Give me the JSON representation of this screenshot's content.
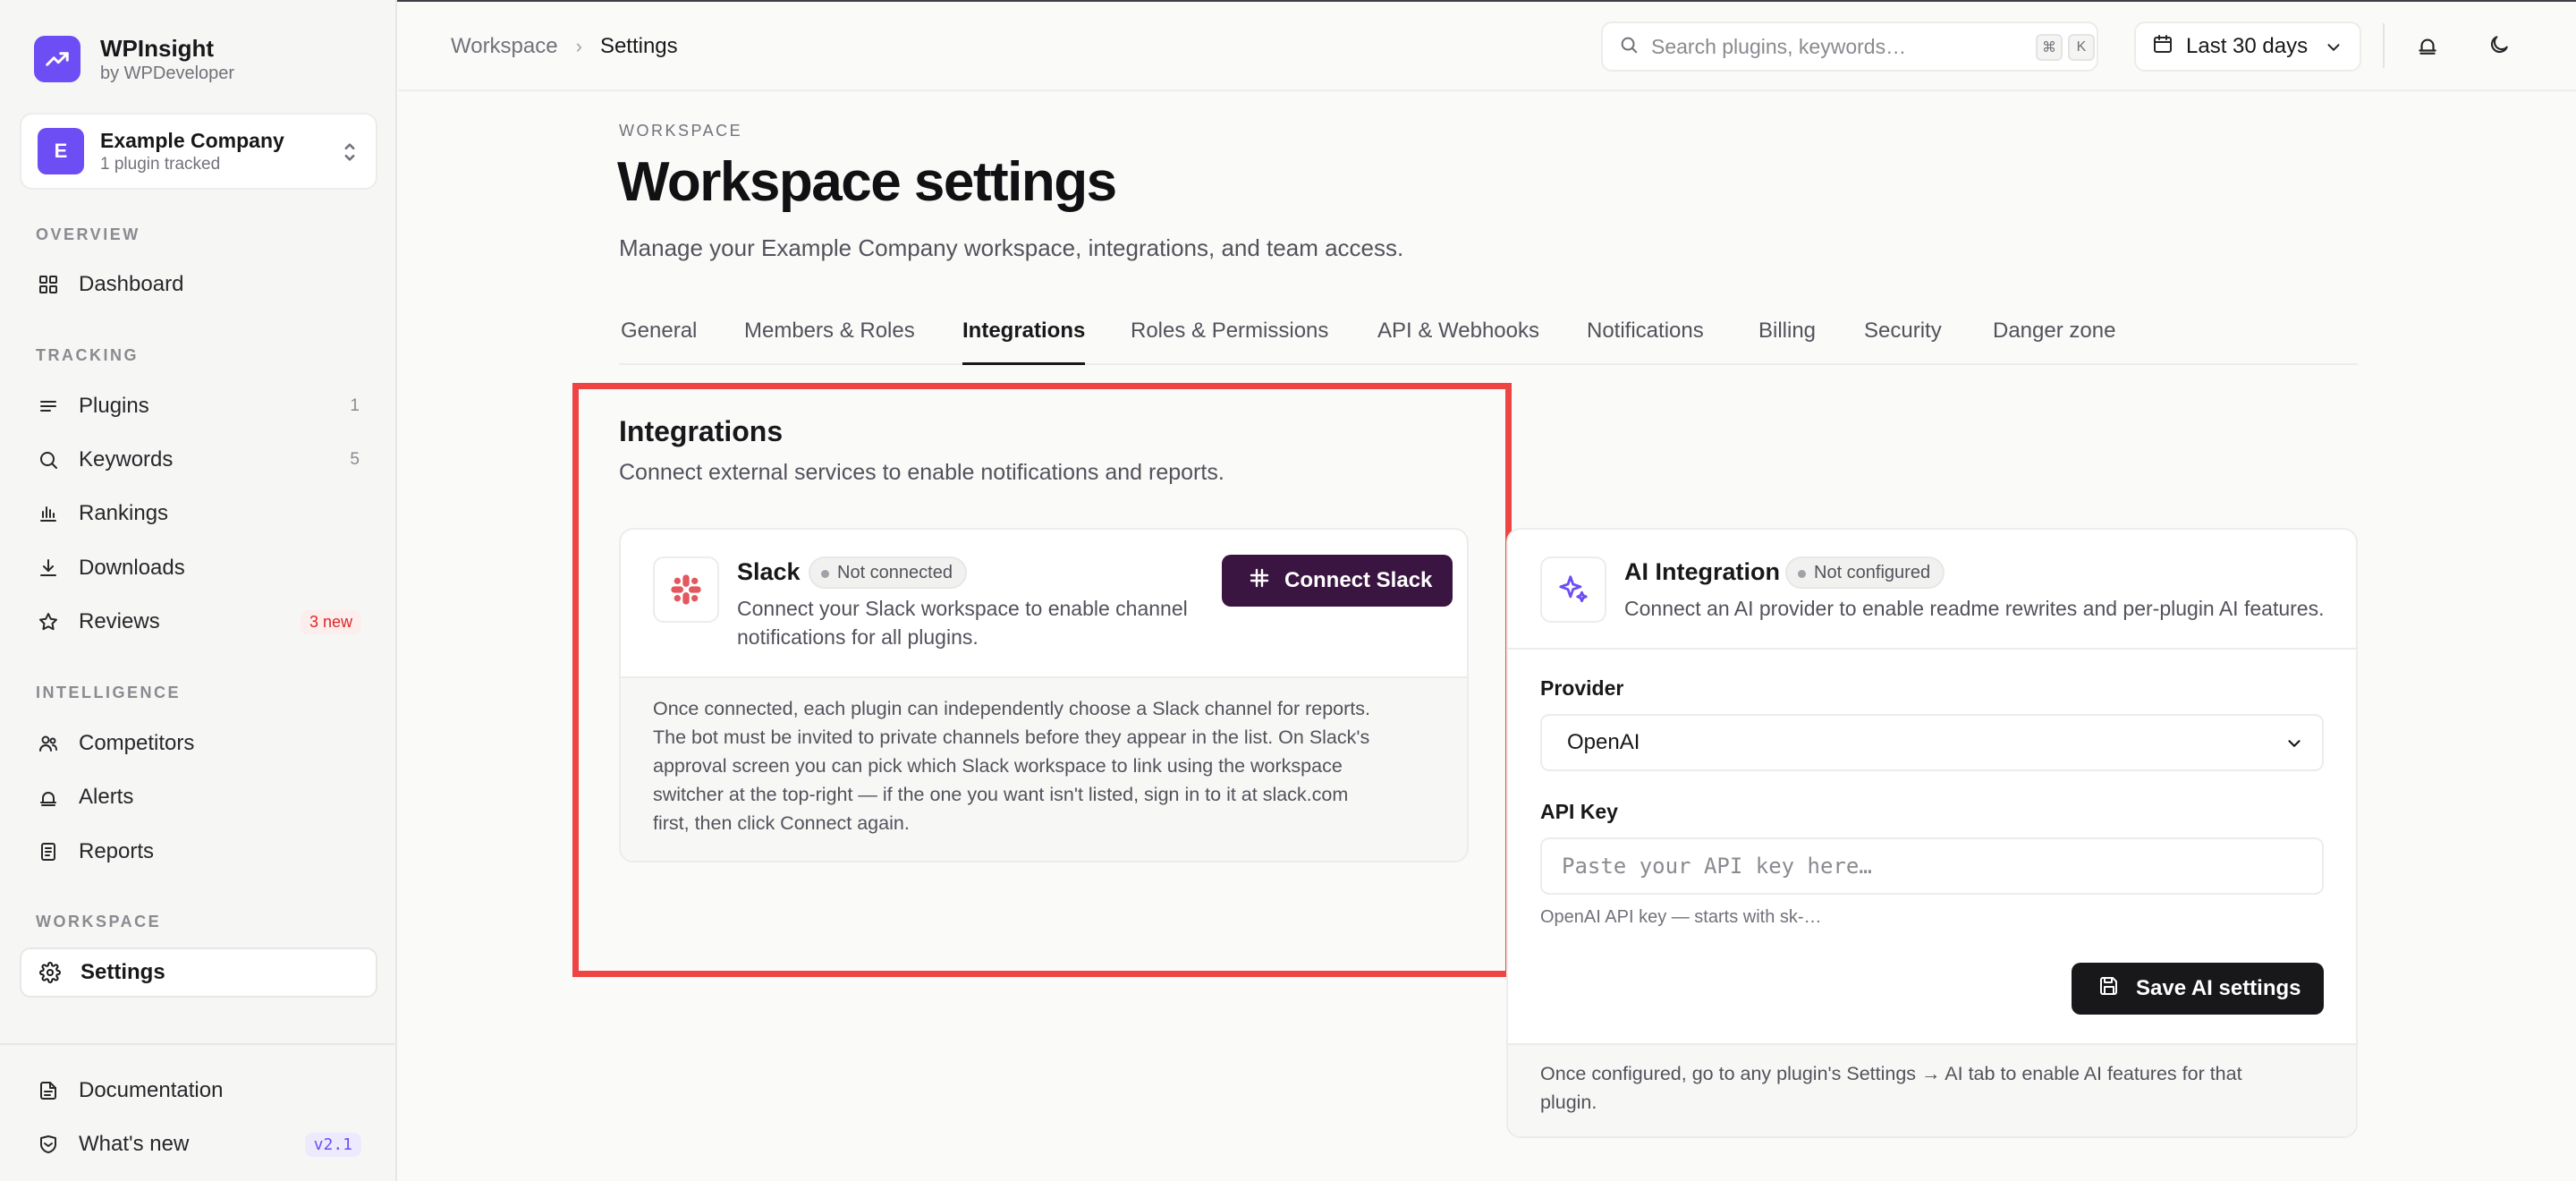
{
  "brand": {
    "name": "WPInsight",
    "sub": "by WPDeveloper"
  },
  "workspace": {
    "avatar": "E",
    "name": "Example Company",
    "sub": "1 plugin tracked"
  },
  "nav": {
    "overview": "OVERVIEW",
    "tracking": "TRACKING",
    "intelligence": "INTELLIGENCE",
    "workspace": "WORKSPACE",
    "dashboard": "Dashboard",
    "plugins": {
      "label": "Plugins",
      "count": "1"
    },
    "keywords": {
      "label": "Keywords",
      "count": "5"
    },
    "rankings": "Rankings",
    "downloads": "Downloads",
    "reviews": {
      "label": "Reviews",
      "badge": "3 new"
    },
    "competitors": "Competitors",
    "alerts": "Alerts",
    "reports": "Reports",
    "settings": "Settings",
    "documentation": "Documentation",
    "whats_new": {
      "label": "What's new",
      "badge": "v2.1"
    }
  },
  "header": {
    "crumb_1": "Workspace",
    "crumb_sep": "›",
    "crumb_2": "Settings",
    "search_placeholder": "Search plugins, keywords…",
    "kbd_1": "⌘",
    "kbd_2": "K",
    "date_range": "Last 30 days"
  },
  "page": {
    "eyebrow": "WORKSPACE",
    "title": "Workspace settings",
    "subtitle": "Manage your Example Company workspace, integrations, and team access."
  },
  "tabs": [
    "General",
    "Members & Roles",
    "Integrations",
    "Roles & Permissions",
    "API & Webhooks",
    "Notifications",
    "Billing",
    "Security",
    "Danger zone"
  ],
  "integrations": {
    "title": "Integrations",
    "subtitle": "Connect external services to enable notifications and reports.",
    "slack": {
      "name": "Slack",
      "status": "Not connected",
      "desc_1": "Connect your Slack workspace to enable channel",
      "desc_2": "notifications for all plugins.",
      "button": "Connect Slack",
      "foot": [
        "Once connected, each plugin can independently choose a Slack channel for reports.",
        "The bot must be invited to private channels before they appear in the list. On Slack's",
        "approval screen you can pick which Slack workspace to link using the workspace",
        "switcher at the top-right — if the one you want isn't listed, sign in to it at slack.com",
        "first, then click Connect again."
      ]
    },
    "ai": {
      "name": "AI Integration",
      "status": "Not configured",
      "desc": "Connect an AI provider to enable readme rewrites and per-plugin AI features.",
      "provider_label": "Provider",
      "provider_value": "OpenAI",
      "apikey_label": "API Key",
      "apikey_placeholder": "Paste your API key here…",
      "apikey_hint": "OpenAI API key — starts with sk-…",
      "save_button": "Save AI settings",
      "foot": [
        "Once configured, go to any plugin's Settings → AI tab to enable AI features for that",
        "plugin."
      ]
    }
  },
  "colors": {
    "accent": "#6d4ef5",
    "slack_button": "#3b1541",
    "highlight": "#ef4444"
  }
}
